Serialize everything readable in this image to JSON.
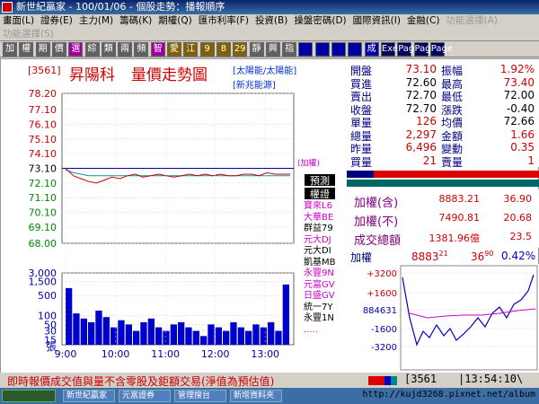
{
  "window": {
    "title": "新世紀贏家 - 100/01/06 - 個股走勢：播報順序"
  },
  "menu": {
    "row1": [
      "畫面(L)",
      "證券(E)",
      "主力(M)",
      "籌碼(K)",
      "期權(Q)",
      "匯市利率(F)",
      "投資(B)",
      "操盤密碼(D)",
      "國際資訊(I)",
      "金融(C)",
      "功能選擇(A)",
      "功能選擇(S)"
    ],
    "row2": [
      "檢視(V)",
      "設定(S)",
      "工具(T)",
      "說明(H)"
    ]
  },
  "toolbar": {
    "buttons": [
      "加",
      "權",
      "期",
      "價",
      "選",
      "綜",
      "類",
      "兩",
      "頻",
      "智",
      "愛",
      "江",
      "9",
      "8",
      "29",
      "靜",
      "興",
      "指",
      "",
      "",
      "",
      "",
      "成",
      "Exe",
      "Page",
      "Page",
      "Page"
    ]
  },
  "stock": {
    "code": "[3561]",
    "name": "昇陽科",
    "chart_title": "量價走勢圖",
    "tag1": "[太陽能/太陽能]",
    "tag2": "[新兆能源]",
    "weighted_label": "(加權)",
    "label_box1": "預測",
    "label_box2": "權證"
  },
  "quote": {
    "rows": [
      {
        "l1": "開盤",
        "v1": "73.10",
        "l2": "振幅",
        "v2": "1.92%",
        "c1": "#cc0000",
        "c2": "#cc0000"
      },
      {
        "l1": "買進",
        "v1": "72.60",
        "l2": "最高",
        "v2": "73.40",
        "c1": "#000000",
        "c2": "#cc0000"
      },
      {
        "l1": "賣出",
        "v1": "72.70",
        "l2": "最低",
        "v2": "72.00",
        "c1": "#000000",
        "c2": "#000000"
      },
      {
        "l1": "收盤",
        "v1": "72.70",
        "l2": "漲跌",
        "v2": "-0.40",
        "c1": "#000000",
        "c2": "#000000"
      },
      {
        "l1": "單量",
        "v1": "126",
        "l2": "均價",
        "v2": "72.66",
        "c1": "#cc0000",
        "c2": "#000000"
      },
      {
        "l1": "總量",
        "v1": "2,297",
        "l2": "金額",
        "v2": "1.66",
        "c1": "#cc0000",
        "c2": "#cc0000"
      },
      {
        "l1": "昨量",
        "v1": "6,496",
        "l2": "變動",
        "v2": "0.35",
        "c1": "#cc0000",
        "c2": "#cc0000"
      },
      {
        "l1": "買量",
        "v1": "21",
        "l2": "賣量",
        "v2": "1",
        "c1": "#cc0000",
        "c2": "#cc0000"
      }
    ]
  },
  "market": {
    "rows": [
      {
        "label": "加權(含)",
        "value": "8883.21",
        "change": "36.90"
      },
      {
        "label": "加權(不)",
        "value": "7490.81",
        "change": "20.68"
      },
      {
        "label": "成交總額",
        "value": "1381.96億",
        "change": "23.5"
      }
    ]
  },
  "index_bar": {
    "label": "加權",
    "value": "8883",
    "value_dec": "21",
    "change": "36",
    "change_dec": "90",
    "pct": "0.42%"
  },
  "mini_chart": {
    "ticks": [
      "+3200",
      "+1600",
      "884631",
      "-1600",
      "-3200"
    ]
  },
  "side_list": [
    "寶來L6",
    "大華BE",
    "群益79",
    "元大DJ",
    "元大DI",
    "凱基MB",
    "永豐9N",
    "元富GV",
    "日盛GV",
    "統一7Y",
    "永豐1N",
    "....."
  ],
  "side_colors": [
    "#cc00cc",
    "#cc00cc",
    "#000000",
    "#cc00cc",
    "#000000",
    "#000000",
    "#cc00cc",
    "#cc00cc",
    "#cc00cc",
    "#000000",
    "#000000",
    "#cc00cc"
  ],
  "status": {
    "message": "即時報價成交值與量不含零股及鉅額交易(淨值為預估值)",
    "code": "3561",
    "time": "13:54:10"
  },
  "taskbar": {
    "items": [
      "新世紀贏家",
      "元富證券",
      "管理搜台",
      "新增資料夾"
    ],
    "watermark": "http://kujd3268.pixnet.net/album"
  },
  "chart_data": {
    "type": "line",
    "price_ticks": [
      "78.20",
      "77.10",
      "76.10",
      "75.10",
      "74.10",
      "73.10",
      "72.10",
      "71.10",
      "70.10",
      "69.10",
      "68.00"
    ],
    "volume_ticks": [
      "3,000",
      "1,500",
      "500",
      "100",
      "50",
      "30",
      "15"
    ],
    "volume_unit": "張",
    "time_ticks": [
      "9:00",
      "10:00",
      "11:00",
      "12:00",
      "13:00"
    ],
    "reference_price": 73.1,
    "price_series": [
      73.1,
      72.6,
      72.4,
      72.2,
      72.1,
      72.3,
      72.5,
      72.4,
      72.6,
      72.7,
      72.5,
      72.6,
      72.7,
      72.6,
      72.5,
      72.6,
      72.7,
      72.6,
      72.7,
      72.6,
      72.7,
      72.6,
      72.6,
      72.7,
      72.7,
      72.6,
      72.8,
      72.7,
      72.7,
      72.7
    ],
    "avg_series": [
      73.0,
      72.8,
      72.7,
      72.6,
      72.6,
      72.6,
      72.6,
      72.6,
      72.6,
      72.6,
      72.6,
      72.6,
      72.6,
      72.6,
      72.6,
      72.6,
      72.6,
      72.6,
      72.6,
      72.6,
      72.6,
      72.6,
      72.6,
      72.6,
      72.6,
      72.6,
      72.6,
      72.6,
      72.6,
      72.6
    ],
    "volume_series": [
      900,
      120,
      80,
      60,
      150,
      90,
      40,
      70,
      50,
      30,
      60,
      80,
      40,
      30,
      50,
      60,
      40,
      30,
      20,
      50,
      40,
      30,
      60,
      40,
      30,
      50,
      40,
      60,
      30,
      1200
    ]
  }
}
